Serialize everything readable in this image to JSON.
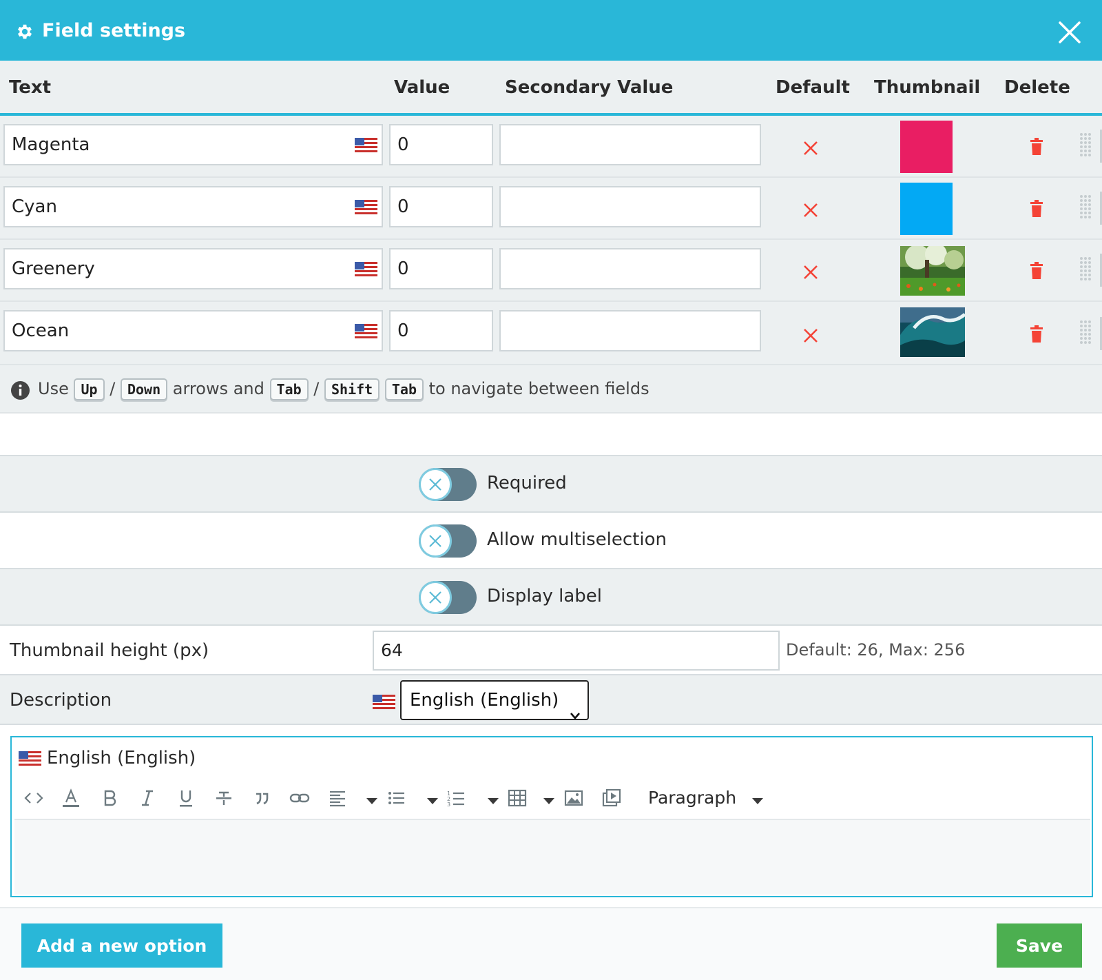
{
  "header": {
    "title": "Field settings"
  },
  "table": {
    "columns": [
      "Text",
      "Value",
      "Secondary Value",
      "Default",
      "Thumbnail",
      "Delete"
    ],
    "rows": [
      {
        "text": "Magenta",
        "value": "0",
        "secondary_value": "",
        "thumbnail": "color",
        "thumbnail_color": "#e91e63"
      },
      {
        "text": "Cyan",
        "value": "0",
        "secondary_value": "",
        "thumbnail": "color",
        "thumbnail_color": "#03a9f4"
      },
      {
        "text": "Greenery",
        "value": "0",
        "secondary_value": "",
        "thumbnail": "image-greenery"
      },
      {
        "text": "Ocean",
        "value": "0",
        "secondary_value": "",
        "thumbnail": "image-ocean"
      }
    ]
  },
  "hint": {
    "use": "Use",
    "up": "Up",
    "slash": "/",
    "down": "Down",
    "arrows_and": "arrows and",
    "tab": "Tab",
    "shift": "Shift",
    "tail": "to navigate between fields"
  },
  "toggles": [
    {
      "label": "Required",
      "on": false
    },
    {
      "label": "Allow multiselection",
      "on": false
    },
    {
      "label": "Display label",
      "on": false
    }
  ],
  "thumbnail_height": {
    "label": "Thumbnail height (px)",
    "value": "64",
    "help": "Default: 26, Max: 256"
  },
  "description": {
    "label": "Description",
    "language_selected": "English (English)"
  },
  "editor": {
    "language": "English (English)",
    "block_format": "Paragraph"
  },
  "footer": {
    "add_label": "Add a new option",
    "save_label": "Save"
  },
  "colors": {
    "accent": "#29b7d8",
    "save": "#4caf50",
    "danger": "#f44336",
    "toggle_track": "#607d8b"
  }
}
